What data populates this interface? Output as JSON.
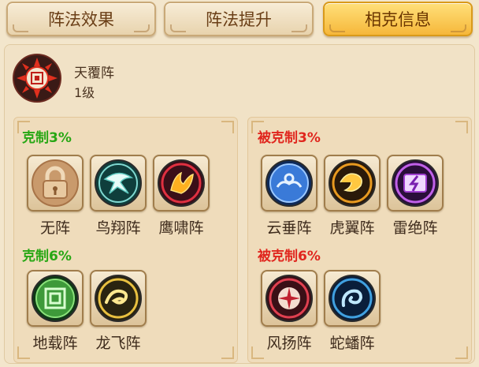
{
  "tabs": [
    {
      "label": "阵法效果",
      "active": false
    },
    {
      "label": "阵法提升",
      "active": false
    },
    {
      "label": "相克信息",
      "active": true
    }
  ],
  "formation": {
    "name": "天覆阵",
    "level": "1级",
    "emblem_icon": "tianfu-formation-icon"
  },
  "counter": {
    "groups": [
      {
        "label": "克制3%",
        "items": [
          {
            "name": "无阵",
            "icon": "lock-icon"
          },
          {
            "name": "鸟翔阵",
            "icon": "bird-formation-icon"
          },
          {
            "name": "鹰啸阵",
            "icon": "eagle-formation-icon"
          }
        ]
      },
      {
        "label": "克制6%",
        "items": [
          {
            "name": "地载阵",
            "icon": "earth-formation-icon"
          },
          {
            "name": "龙飞阵",
            "icon": "dragon-formation-icon"
          }
        ]
      }
    ]
  },
  "countered_by": {
    "groups": [
      {
        "label": "被克制3%",
        "items": [
          {
            "name": "云垂阵",
            "icon": "cloud-formation-icon"
          },
          {
            "name": "虎翼阵",
            "icon": "tiger-formation-icon"
          },
          {
            "name": "雷绝阵",
            "icon": "thunder-formation-icon"
          }
        ]
      },
      {
        "label": "被克制6%",
        "items": [
          {
            "name": "风扬阵",
            "icon": "wind-formation-icon"
          },
          {
            "name": "蛇蟠阵",
            "icon": "snake-formation-icon"
          }
        ]
      }
    ]
  },
  "colors": {
    "counter_label": "#27a714",
    "countered_label": "#e0261e",
    "active_tab": "#f6b73a"
  }
}
